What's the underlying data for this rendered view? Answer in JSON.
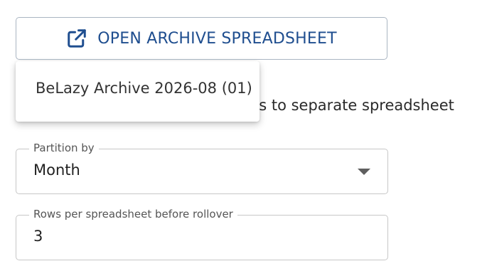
{
  "open_button": {
    "label": "OPEN ARCHIVE SPREADSHEET",
    "icon": "open-in-new-icon",
    "color": "#1f4e8f"
  },
  "menu": {
    "items": [
      {
        "label": "BeLazy Archive 2026-08 (01)"
      }
    ]
  },
  "checkbox": {
    "label_visible_fragment": "ts to separate spreadsheet",
    "checked": false
  },
  "partition_field": {
    "legend": "Partition by",
    "value": "Month"
  },
  "rows_field": {
    "legend": "Rows per spreadsheet before rollover",
    "value": "3"
  }
}
